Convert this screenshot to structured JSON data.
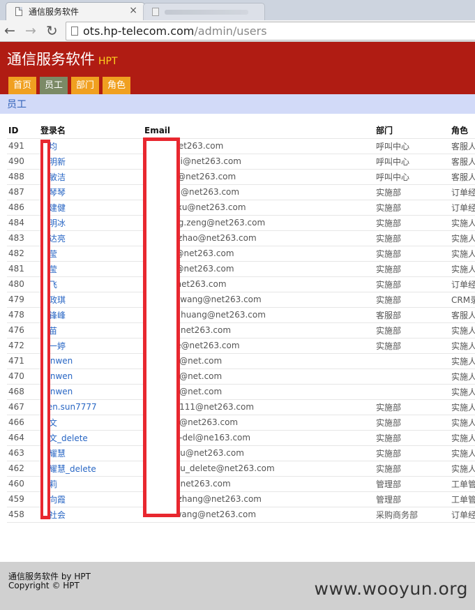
{
  "browser": {
    "tab_title": "通信服务软件",
    "tab_close": "×",
    "url_host": "ots.hp-telecom.com",
    "url_path": "/admin/users",
    "back": "←",
    "forward": "→",
    "reload": "↻"
  },
  "header": {
    "title": "通信服务软件",
    "brand": "HPT",
    "nav": [
      {
        "label": "首页",
        "active": false
      },
      {
        "label": "员工",
        "active": true
      },
      {
        "label": "部门",
        "active": false
      },
      {
        "label": "角色",
        "active": false
      }
    ],
    "accent": "#b01c13"
  },
  "section": {
    "title": "员工"
  },
  "table": {
    "columns": [
      "ID",
      "登录名",
      "Email",
      "部门",
      "角色"
    ],
    "rows": [
      {
        "id": "491",
        "login": "金均",
        "email": "jingo@net263.com",
        "dept": "呼叫中心",
        "role": "客服人"
      },
      {
        "id": "490",
        "login": "马明新",
        "email": "mingxinji@net263.com",
        "dept": "呼叫中心",
        "role": "客服人"
      },
      {
        "id": "488",
        "login": "李敏洁",
        "email": "minjie.li@net263.com",
        "dept": "呼叫中心",
        "role": "客服人"
      },
      {
        "id": "487",
        "login": "杨琴琴",
        "email": "qin.yang@net263.com",
        "dept": "实施部",
        "role": "订单经"
      },
      {
        "id": "486",
        "login": "徐建健",
        "email": "xiaojianxu@net263.com",
        "dept": "实施部",
        "role": "订单经"
      },
      {
        "id": "484",
        "login": "曾明冰",
        "email": "mingbing.zeng@net263.com",
        "dept": "实施部",
        "role": "实施人"
      },
      {
        "id": "483",
        "login": "赵达亮",
        "email": "daliang.zhao@net263.com",
        "dept": "实施部",
        "role": "实施人"
      },
      {
        "id": "482",
        "login": "何莹",
        "email": "ying.he@net263.com",
        "dept": "实施部",
        "role": "实施人"
      },
      {
        "id": "481",
        "login": "何莹",
        "email": "ying.he@net263.com",
        "dept": "实施部",
        "role": "实施人"
      },
      {
        "id": "480",
        "login": "于飞",
        "email": "fei.yu@net263.com",
        "dept": "实施部",
        "role": "订单经"
      },
      {
        "id": "479",
        "login": "王政琪",
        "email": "zhengqi.wang@net263.com",
        "dept": "实施部",
        "role": "CRM录"
      },
      {
        "id": "478",
        "login": "黄锋峰",
        "email": "shufeng.huang@net263.com",
        "dept": "客服部",
        "role": "客服人"
      },
      {
        "id": "476",
        "login": "李苗",
        "email": "miao.li@net263.com",
        "dept": "实施部",
        "role": "实施人"
      },
      {
        "id": "472",
        "login": "何一婷",
        "email": "yiting.he@net263.com",
        "dept": "实施部",
        "role": "实施人"
      },
      {
        "id": "471",
        "login": "sunwen",
        "email": "wen.sun@net.com",
        "dept": "",
        "role": "实施人"
      },
      {
        "id": "470",
        "login": "sunwen",
        "email": "wen.sun@net.com",
        "dept": "",
        "role": "实施人"
      },
      {
        "id": "468",
        "login": "sunwen",
        "email": "wen.sun@net.com",
        "dept": "",
        "role": "实施人"
      },
      {
        "id": "467",
        "login": "wen.sun7777",
        "email": "wen.sun111@net263.com",
        "dept": "实施部",
        "role": "实施人"
      },
      {
        "id": "466",
        "login": "孙文",
        "email": "wen.sun@net263.com",
        "dept": "实施部",
        "role": "实施人"
      },
      {
        "id": "464",
        "login": "孙文_delete",
        "email": "wen.sun-del@ne163.com",
        "dept": "实施部",
        "role": "实施人"
      },
      {
        "id": "463",
        "login": "俞耀慧",
        "email": "yaohui.yu@net263.com",
        "dept": "实施部",
        "role": "实施人"
      },
      {
        "id": "462",
        "login": "俞耀慧_delete",
        "email": "yaohui.yu_delete@net263.com",
        "dept": "实施部",
        "role": "实施人"
      },
      {
        "id": "460",
        "login": "陈莉",
        "email": "li.chen@net263.com",
        "dept": "管理部",
        "role": "工单管"
      },
      {
        "id": "459",
        "login": "张向霞",
        "email": "yongxiazhang@net263.com",
        "dept": "管理部",
        "role": "工单管"
      },
      {
        "id": "458",
        "login": "王社会",
        "email": "shehui.wang@net263.com",
        "dept": "采购商务部",
        "role": "订单经"
      }
    ]
  },
  "footer": {
    "line1": "通信服务软件 by HPT",
    "line2": "Copyright © HPT",
    "watermark": "www.wooyun.org"
  }
}
